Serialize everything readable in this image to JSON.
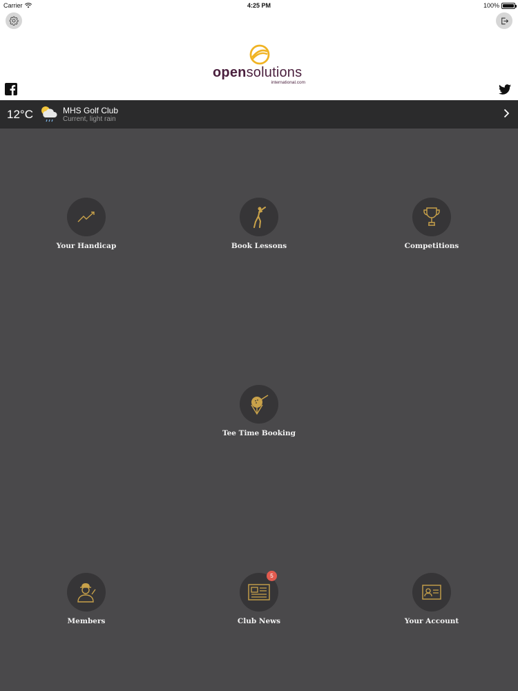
{
  "status_bar": {
    "carrier": "Carrier",
    "time": "4:25 PM",
    "battery": "100%"
  },
  "header": {
    "logo": {
      "text_part1": "open",
      "text_part2": "solutions",
      "subtext": "international.com",
      "brand_color": "#4a1f3d",
      "accent_color": "#f0b323"
    },
    "icons": [
      "gear-icon",
      "logout-icon",
      "facebook-icon",
      "twitter-icon"
    ]
  },
  "weather": {
    "temperature": "12°C",
    "location": "MHS Golf Club",
    "condition": "Current, light rain"
  },
  "tiles": [
    {
      "label": "Your Handicap",
      "icon": "handicap-chart-icon"
    },
    {
      "label": "Book Lessons",
      "icon": "golfer-icon"
    },
    {
      "label": "Competitions",
      "icon": "trophy-icon"
    },
    {
      "label": "Tee Time Booking",
      "icon": "golf-tee-icon"
    },
    {
      "label": "Members",
      "icon": "member-icon"
    },
    {
      "label": "Club News",
      "icon": "newspaper-icon",
      "badge": "5"
    },
    {
      "label": "Your Account",
      "icon": "account-card-icon"
    }
  ],
  "colors": {
    "background": "#4a494b",
    "weather_bar": "#2b2b2c",
    "icon_circle": "#363537",
    "icon_gold": "#c9a24a",
    "badge": "#e25b4f"
  }
}
